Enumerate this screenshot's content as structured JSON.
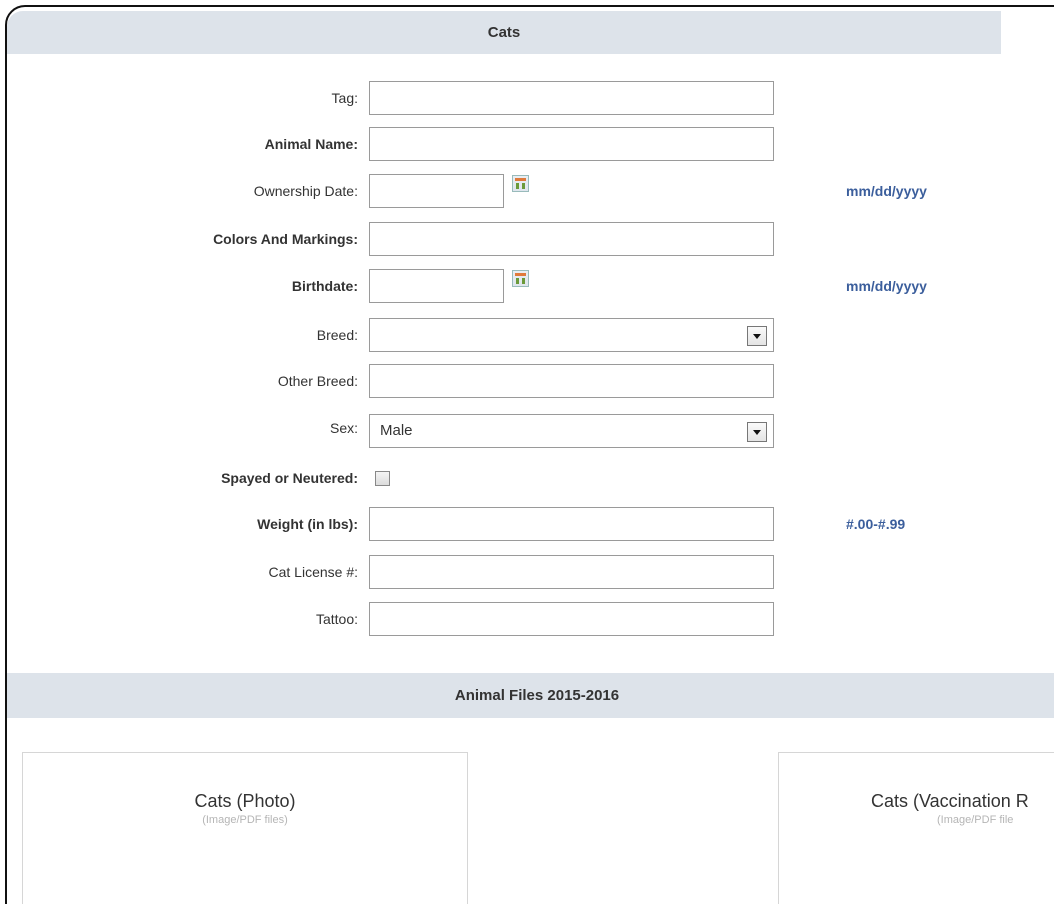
{
  "header": {
    "title": "Cats"
  },
  "fields": {
    "tag": {
      "label": "Tag:",
      "value": ""
    },
    "animal_name": {
      "label": "Animal Name:",
      "value": ""
    },
    "ownership_date": {
      "label": "Ownership Date:",
      "value": "",
      "hint": "mm/dd/yyyy"
    },
    "colors": {
      "label": "Colors And Markings:",
      "value": ""
    },
    "birthdate": {
      "label": "Birthdate:",
      "value": "",
      "hint": "mm/dd/yyyy"
    },
    "breed": {
      "label": "Breed:",
      "value": ""
    },
    "other_breed": {
      "label": "Other Breed:",
      "value": ""
    },
    "sex": {
      "label": "Sex:",
      "value": "Male"
    },
    "spayed": {
      "label": "Spayed or Neutered:",
      "checked": false
    },
    "weight": {
      "label": "Weight (in lbs):",
      "value": "",
      "hint": "#.00-#.99"
    },
    "license": {
      "label": "Cat License #:",
      "value": ""
    },
    "tattoo": {
      "label": "Tattoo:",
      "value": ""
    }
  },
  "files_section": {
    "title": "Animal Files 2015-2016",
    "cards": [
      {
        "title": "Cats (Photo)",
        "subtitle": "(Image/PDF files)"
      },
      {
        "title": "Cats (Vaccination R",
        "subtitle": "(Image/PDF file"
      }
    ]
  },
  "colors": {
    "header_bg": "#dde3ea",
    "hint": "#3b5e9c",
    "border": "#111111"
  },
  "icons": {
    "calendar": "calendar-icon",
    "dropdown": "chevron-down-icon"
  }
}
